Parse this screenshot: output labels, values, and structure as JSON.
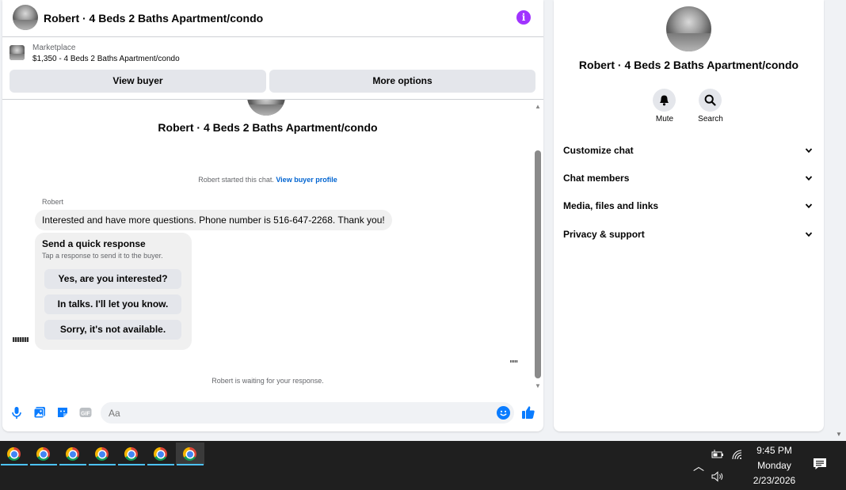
{
  "header": {
    "title": "Robert · 4 Beds 2 Baths Apartment/condo"
  },
  "listing": {
    "source_label": "Marketplace",
    "detail": "$1,350 - 4 Beds 2 Baths Apartment/condo",
    "view_buyer_label": "View buyer",
    "more_options_label": "More options"
  },
  "conversation": {
    "title": "Robert · 4 Beds 2 Baths Apartment/condo",
    "started_text": "Robert started this chat.",
    "view_profile_link": "View buyer profile",
    "sender_name": "Robert",
    "message": "Interested and have more questions. Phone number is 516-647-2268. Thank you!",
    "quick_response": {
      "title": "Send a quick response",
      "subtitle": "Tap a response to send it to the buyer.",
      "options": [
        "Yes, are you interested?",
        "In talks. I'll let you know.",
        "Sorry, it's not available."
      ]
    },
    "waiting_text": "Robert is waiting for your response."
  },
  "composer": {
    "placeholder": "Aa"
  },
  "details": {
    "title": "Robert · 4 Beds 2 Baths Apartment/condo",
    "mute_label": "Mute",
    "search_label": "Search",
    "sections": [
      "Customize chat",
      "Chat members",
      "Media, files and links",
      "Privacy & support"
    ]
  },
  "taskbar": {
    "apps": [
      "chrome-icon",
      "chrome-icon",
      "chrome-icon",
      "chrome-icon",
      "chrome-icon",
      "chrome-icon",
      "chrome-icon"
    ],
    "active_app_index": 6,
    "time": "9:45 PM",
    "day": "Monday",
    "date": "2/23/2026"
  },
  "colors": {
    "accent_purple": "#a033ff",
    "link_blue": "#0064d1",
    "messenger_blue": "#0a7cff",
    "taskbar_bg": "#1f1f1f"
  }
}
